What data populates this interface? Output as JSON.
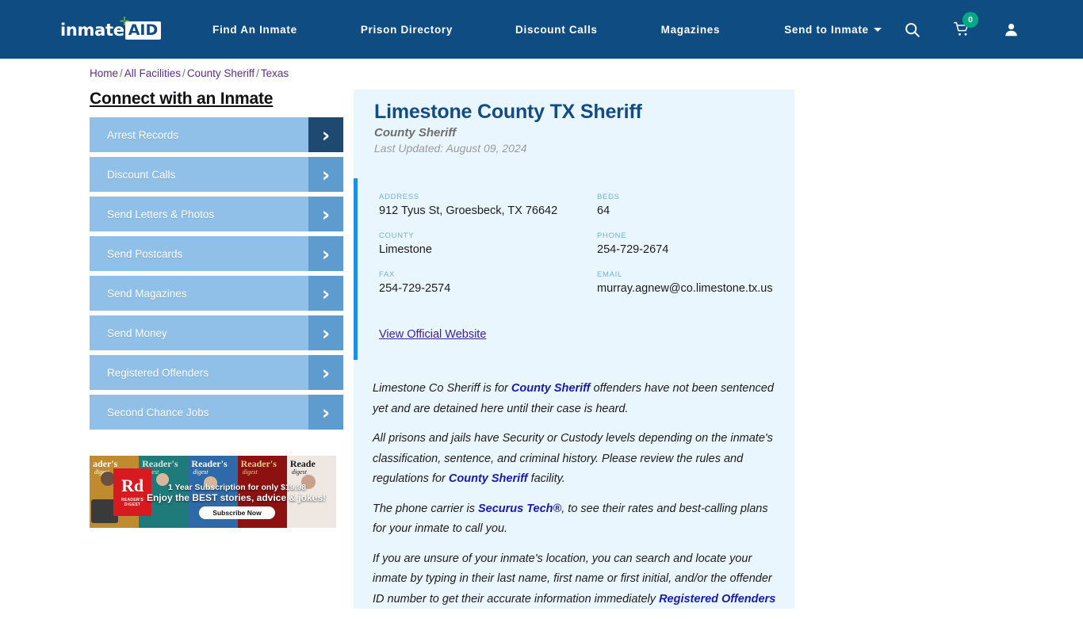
{
  "header": {
    "logo": {
      "word": "inmate",
      "box": "AID",
      "plus_icon": "plus-icon"
    },
    "nav": [
      {
        "label": "Find An Inmate"
      },
      {
        "label": "Prison Directory"
      },
      {
        "label": "Discount Calls"
      },
      {
        "label": "Magazines"
      },
      {
        "label": "Send to Inmate",
        "has_caret": true
      }
    ],
    "icons": {
      "search": "search-icon",
      "cart": "cart-icon",
      "cart_badge": "0",
      "account": "user-icon"
    },
    "colors": {
      "background": "#0f4c81",
      "badge": "#00a884",
      "logo_plus": "#74b843"
    }
  },
  "breadcrumb": {
    "items": [
      "Home",
      "All Facilities",
      "County Sheriff",
      "Texas"
    ],
    "separator": "/"
  },
  "sidebar": {
    "title": "Connect with an Inmate",
    "items": [
      {
        "label": "Arrest Records",
        "active": true
      },
      {
        "label": "Discount Calls",
        "active": false
      },
      {
        "label": "Send Letters & Photos",
        "active": false
      },
      {
        "label": "Send Postcards",
        "active": false
      },
      {
        "label": "Send Magazines",
        "active": false
      },
      {
        "label": "Send Money",
        "active": false
      },
      {
        "label": "Registered Offenders",
        "active": false
      },
      {
        "label": "Second Chance Jobs",
        "active": false
      }
    ],
    "colors": {
      "button": "#90c0e8",
      "chevron": "#5e9ccf",
      "chevron_active": "#1e4a72"
    }
  },
  "ad": {
    "brand": "Rd",
    "brand_sub": "READER'S DIGEST",
    "line1": "1 Year Subscription for only $19.98",
    "line2": "Enjoy the BEST stories, advice & jokes!",
    "cta": "Subscribe Now",
    "covers": [
      {
        "title": "ader's",
        "sub": "digest"
      },
      {
        "title": "Reader's",
        "sub": "digest"
      },
      {
        "title": "Reader's",
        "sub": "digest"
      },
      {
        "title": "Reader's",
        "sub": "digest"
      },
      {
        "title": "Reade",
        "sub": "digest"
      }
    ]
  },
  "facility": {
    "name": "Limestone County TX Sheriff",
    "type": "County Sheriff",
    "last_updated": "Last Updated: August 09, 2024",
    "fields": [
      {
        "label": "ADDRESS",
        "value": "912 Tyus St, Groesbeck, TX 76642"
      },
      {
        "label": "BEDS",
        "value": "64"
      },
      {
        "label": "COUNTY",
        "value": "Limestone"
      },
      {
        "label": "PHONE",
        "value": "254-729-2674"
      },
      {
        "label": "FAX",
        "value": "254-729-2574"
      },
      {
        "label": "EMAIL",
        "value": "murray.agnew@co.limestone.tx.us"
      }
    ],
    "website_link": "View Official Website",
    "accent_color": "#1f8fe0",
    "panel_background": "#eaf6fd"
  },
  "body": {
    "p1_a": "Limestone Co Sheriff is for ",
    "p1_link": "County Sheriff",
    "p1_b": " offenders have not been sentenced yet and are detained here until their case is heard.",
    "p2_a": "All prisons and jails have Security or Custody levels depending on the inmate's classification, sentence, and criminal history. Please review the rules and regulations for ",
    "p2_link": "County Sheriff",
    "p2_b": " facility.",
    "p3_a": "The phone carrier is ",
    "p3_link": "Securus Tech®",
    "p3_b": ", to see their rates and best-calling plans for your inmate to call you.",
    "p4_a": "If you are unsure of your inmate's location, you can search and locate your inmate by typing in their last name, first name or first initial, and/or the offender ID number to get their accurate information immediately ",
    "p4_link": "Registered Offenders"
  }
}
